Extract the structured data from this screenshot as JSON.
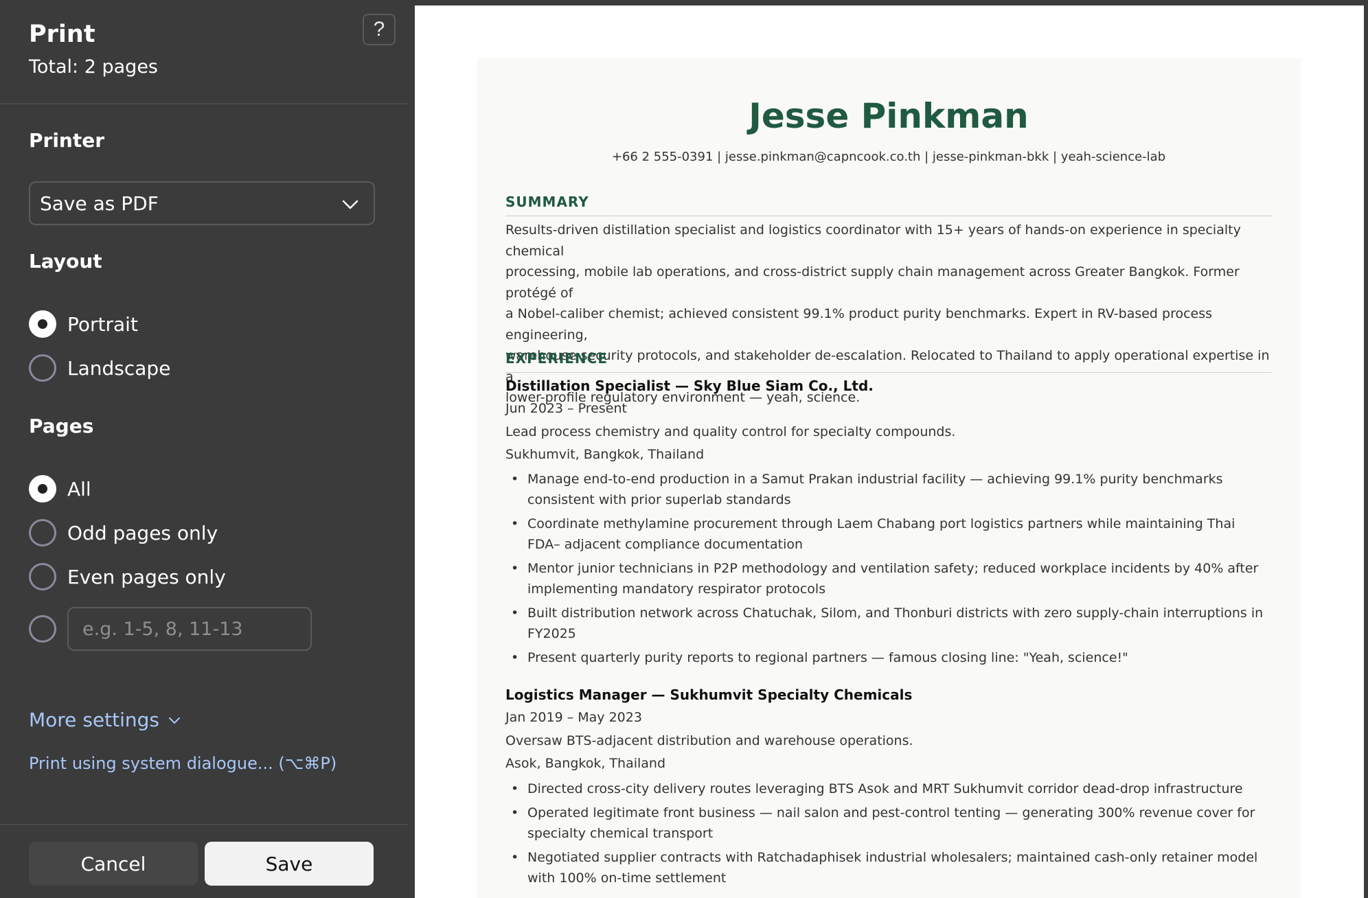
{
  "panel": {
    "title": "Print",
    "total": "Total: 2 pages",
    "help_label": "?",
    "printer": {
      "label": "Printer",
      "selected": "Save as PDF"
    },
    "layout": {
      "label": "Layout",
      "options": [
        "Portrait",
        "Landscape"
      ],
      "selected": "Portrait"
    },
    "pages": {
      "label": "Pages",
      "options": [
        "All",
        "Odd pages only",
        "Even pages only"
      ],
      "selected": "All",
      "custom_placeholder": "e.g. 1-5, 8, 11-13"
    },
    "more_settings": "More settings",
    "system_dialog": "Print using system dialogue... (⌥⌘P)",
    "cancel": "Cancel",
    "save": "Save"
  },
  "colors": {
    "panel_bg": "#3b3b3c",
    "link": "#a9c7f7",
    "resume_accent": "#1f5a41"
  },
  "resume": {
    "name": "Jesse Pinkman",
    "contact": "+66 2 555-0391 | jesse.pinkman@capncook.co.th | jesse-pinkman-bkk | yeah-science-lab",
    "summary_heading": "SUMMARY",
    "summary_lines": [
      "Results-driven distillation specialist and logistics coordinator with 15+ years of hands-on experience in specialty chemical",
      "processing, mobile lab operations, and cross-district supply chain management across Greater Bangkok. Former protégé of",
      "a Nobel-caliber chemist; achieved consistent 99.1% product purity benchmarks. Expert in RV-based process engineering,",
      "warehouse security protocols, and stakeholder de-escalation. Relocated to Thailand to apply operational expertise in a",
      "lower-profile regulatory environment — yeah, science."
    ],
    "experience_heading": "EXPERIENCE",
    "jobs": [
      {
        "title": "Distillation Specialist — Sky Blue Siam Co., Ltd.",
        "dates": "Jun 2023 – Present",
        "description": "Lead process chemistry and quality control for specialty compounds.",
        "location": "Sukhumvit, Bangkok, Thailand",
        "bullets": [
          [
            "Manage end-to-end production in a Samut Prakan industrial facility — achieving 99.1% purity benchmarks consistent",
            "with prior superlab standards"
          ],
          [
            "Coordinate methylamine procurement through Laem Chabang port logistics partners while maintaining Thai FDA–",
            "adjacent compliance documentation"
          ],
          [
            "Mentor junior technicians in P2P methodology and ventilation safety; reduced workplace incidents by 40% after",
            "implementing mandatory respirator protocols"
          ],
          [
            "Built distribution network across Chatuchak, Silom, and Thonburi districts with zero supply-chain interruptions in",
            "FY2025"
          ],
          [
            "Present quarterly purity reports to regional partners — famous closing line: \"Yeah, science!\""
          ]
        ]
      },
      {
        "title": "Logistics Manager — Sukhumvit Specialty Chemicals",
        "dates": "Jan 2019 – May 2023",
        "description": "Oversaw BTS-adjacent distribution and warehouse operations.",
        "location": "Asok, Bangkok, Thailand",
        "bullets": [
          [
            "Directed cross-city delivery routes leveraging BTS Asok and MRT Sukhumvit corridor dead-drop infrastructure"
          ],
          [
            "Operated legitimate front business — nail salon and pest-control tenting — generating 300% revenue cover for",
            "specialty chemical transport"
          ],
          [
            "Negotiated supplier contracts with Ratchadaphisek industrial wholesalers; maintained cash-only retainer model with",
            "100% on-time settlement"
          ]
        ]
      }
    ]
  }
}
